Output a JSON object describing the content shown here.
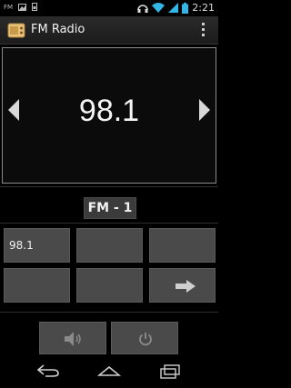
{
  "status_bar": {
    "left_label": "FM",
    "time": "2:21",
    "icons": [
      "fm-notify-icon",
      "image-notify-icon",
      "sim-notify-icon",
      "headphones-icon",
      "wifi-icon",
      "signal-icon",
      "battery-icon"
    ]
  },
  "app": {
    "title": "FM Radio",
    "icon": "radio-app-icon",
    "overflow_icon": "overflow-menu-icon"
  },
  "tuner": {
    "frequency": "98.1",
    "prev_icon": "prev-frequency-icon",
    "next_icon": "next-frequency-icon",
    "band": "FM - 1"
  },
  "presets": [
    {
      "label": "98.1"
    },
    {
      "label": ""
    },
    {
      "label": ""
    },
    {
      "label": ""
    },
    {
      "label": ""
    },
    {
      "label": "",
      "icon": "next-page-arrow-icon"
    }
  ],
  "controls": {
    "speaker_icon": "speaker-icon",
    "power_icon": "power-icon"
  },
  "nav": {
    "back_icon": "back-icon",
    "home_icon": "home-icon",
    "recents_icon": "recents-icon"
  },
  "colors": {
    "background": "#000000",
    "panel_border": "#8a8a8a",
    "button": "#4a4a4a",
    "text": "#f0f0f0"
  }
}
